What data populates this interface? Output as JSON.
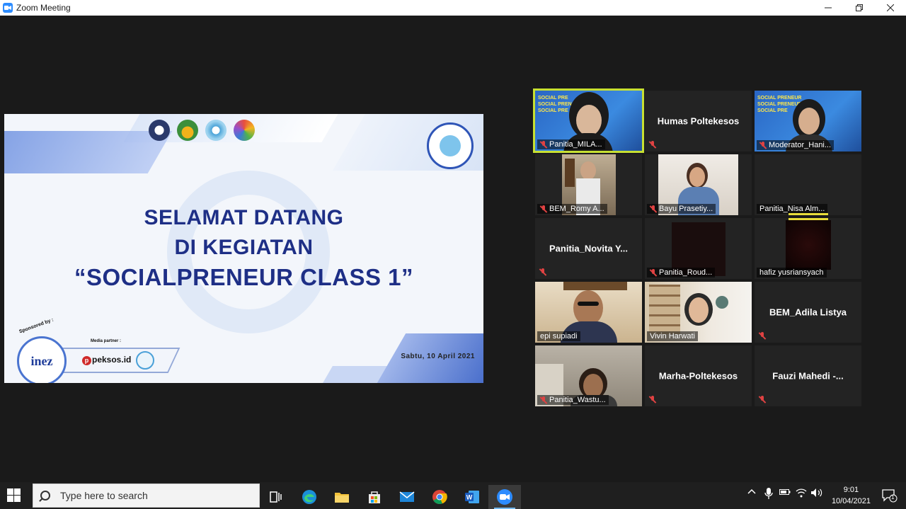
{
  "window": {
    "title": "Zoom Meeting",
    "minimize": "—",
    "restore": "❐",
    "close": "✕"
  },
  "slide": {
    "line1": "SELAMAT DATANG",
    "line2": "DI KEGIATAN",
    "line3": "“SOCIALPRENEUR CLASS 1”",
    "date": "Sabtu, 10 April 2021",
    "sponsored_by": "Sponsored by :",
    "media_partner": "Media partner :",
    "sponsor_name": "inez",
    "partner_name": "peksos.id"
  },
  "gallery": [
    {
      "name": "Panitia_MILA...",
      "muted": true,
      "video": true,
      "active": true
    },
    {
      "name": "Humas Poltekesos",
      "muted": true,
      "video": false
    },
    {
      "name": "Moderator_Hani...",
      "muted": true,
      "video": true
    },
    {
      "name": "BEM_Romy A...",
      "muted": true,
      "video": true
    },
    {
      "name": "Bayu Prasetiy...",
      "muted": true,
      "video": true
    },
    {
      "name": "Panitia_Nisa Alm...",
      "muted": false,
      "video": false,
      "speaking": true
    },
    {
      "name": "Panitia_Novita  Y...",
      "muted": true,
      "video": false
    },
    {
      "name": "Panitia_Roud...",
      "muted": true,
      "video": true
    },
    {
      "name": "hafiz yusriansyach",
      "muted": false,
      "video": true,
      "speaking": true
    },
    {
      "name": "epi supiadi",
      "muted": false,
      "video": true
    },
    {
      "name": "Vivin Harwati",
      "muted": false,
      "video": true
    },
    {
      "name": "BEM_Adila Listya",
      "muted": true,
      "video": false
    },
    {
      "name": "Panitia_Wastu...",
      "muted": true,
      "video": true
    },
    {
      "name": "Marha-Poltekesos",
      "muted": true,
      "video": false
    },
    {
      "name": "Fauzi  Mahedi  -...",
      "muted": true,
      "video": false
    }
  ],
  "taskbar": {
    "search_placeholder": "Type here to search",
    "time": "9:01",
    "date": "10/04/2021",
    "notification_count": "1",
    "apps": [
      "task-view",
      "edge",
      "file-explorer",
      "store",
      "mail",
      "chrome",
      "word",
      "zoom"
    ],
    "active_app": "zoom"
  },
  "colors": {
    "zoom_blue": "#2d8cff",
    "active_speaker": "#c7e032",
    "muted_red": "#e04242",
    "slide_title": "#1e2f86"
  }
}
